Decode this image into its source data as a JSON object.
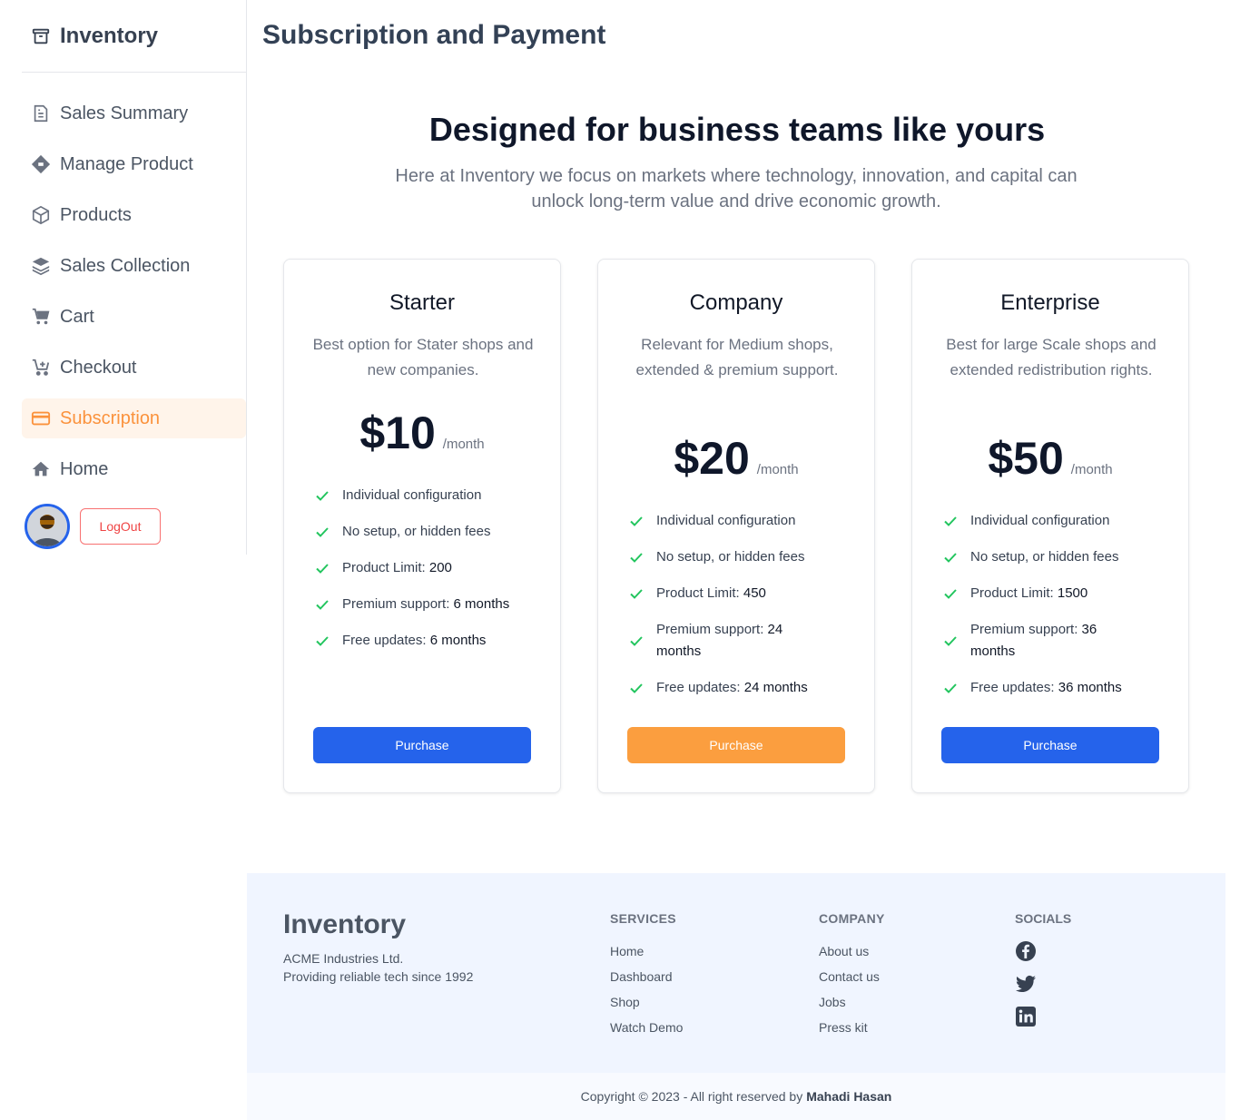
{
  "sidebar": {
    "brand": "Inventory",
    "items": [
      {
        "label": "Sales Summary",
        "icon": "document-icon"
      },
      {
        "label": "Manage Product",
        "icon": "diamond-icon"
      },
      {
        "label": "Products",
        "icon": "box-icon"
      },
      {
        "label": "Sales Collection",
        "icon": "layers-icon"
      },
      {
        "label": "Cart",
        "icon": "cart-icon"
      },
      {
        "label": "Checkout",
        "icon": "cart-plus-icon"
      },
      {
        "label": "Subscription",
        "icon": "credit-card-icon",
        "active": true
      },
      {
        "label": "Home",
        "icon": "home-icon"
      }
    ],
    "logout": "LogOut"
  },
  "main": {
    "title": "Subscription and Payment",
    "hero_title": "Designed for business teams like yours",
    "hero_subtitle": "Here at Inventory we focus on markets where technology, innovation, and capital can unlock long-term value and drive economic growth."
  },
  "plans": [
    {
      "name": "Starter",
      "description": "Best option for Stater shops and new companies.",
      "price": "$10",
      "period": "/month",
      "features": [
        {
          "text": "Individual configuration",
          "value": ""
        },
        {
          "text": "No setup, or hidden fees",
          "value": ""
        },
        {
          "text": "Product Limit: ",
          "value": "200"
        },
        {
          "text": "Premium support: ",
          "value": "6 months"
        },
        {
          "text": "Free updates: ",
          "value": "6 months"
        }
      ],
      "button": "Purchase",
      "button_color": "#2563eb"
    },
    {
      "name": "Company",
      "description": "Relevant for Medium shops, extended & premium support.",
      "price": "$20",
      "period": "/month",
      "features": [
        {
          "text": "Individual configuration",
          "value": ""
        },
        {
          "text": "No setup, or hidden fees",
          "value": ""
        },
        {
          "text": "Product Limit: ",
          "value": "450"
        },
        {
          "text": "Premium support: ",
          "value": "24 months"
        },
        {
          "text": "Free updates: ",
          "value": "24 months"
        }
      ],
      "button": "Purchase",
      "button_color": "#fb9e3f"
    },
    {
      "name": "Enterprise",
      "description": "Best for large Scale shops and extended redistribution rights.",
      "price": "$50",
      "period": "/month",
      "features": [
        {
          "text": "Individual configuration",
          "value": ""
        },
        {
          "text": "No setup, or hidden fees",
          "value": ""
        },
        {
          "text": "Product Limit: ",
          "value": "1500"
        },
        {
          "text": "Premium support: ",
          "value": "36 months"
        },
        {
          "text": "Free updates: ",
          "value": "36 months"
        }
      ],
      "button": "Purchase",
      "button_color": "#2563eb"
    }
  ],
  "footer": {
    "brand": "Inventory",
    "company_name": "ACME Industries Ltd.",
    "tagline": "Providing reliable tech since 1992",
    "services": {
      "title": "SERVICES",
      "links": [
        "Home",
        "Dashboard",
        "Shop",
        "Watch Demo"
      ]
    },
    "company": {
      "title": "COMPANY",
      "links": [
        "About us",
        "Contact us",
        "Jobs",
        "Press kit"
      ]
    },
    "socials": {
      "title": "SOCIALS",
      "icons": [
        "facebook-icon",
        "twitter-icon",
        "linkedin-icon"
      ]
    },
    "copyright": "Copyright © 2023 - All right reserved by",
    "author": "Mahadi Hasan"
  },
  "colors": {
    "accent": "#fb923c",
    "primary": "#2563eb",
    "check": "#22c55e"
  }
}
